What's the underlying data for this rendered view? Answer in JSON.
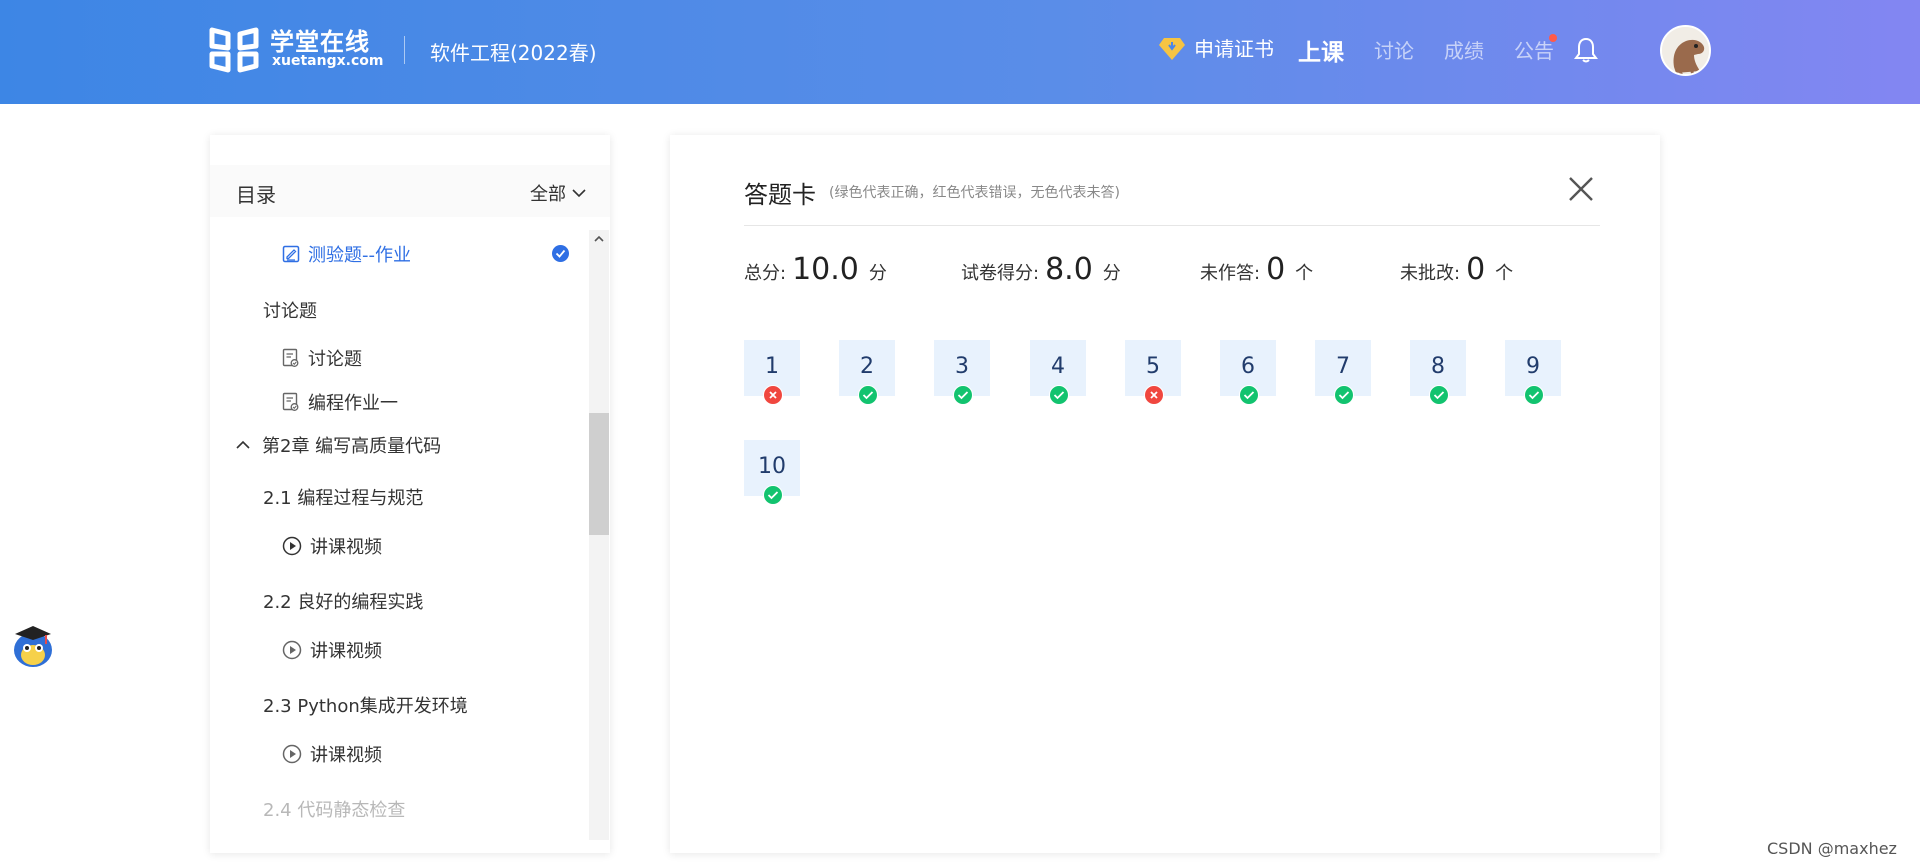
{
  "header": {
    "brand_cn": "学堂在线",
    "brand_en": "xuetangx.com",
    "course_title": "软件工程(2022春)",
    "nav": {
      "certificate": "申请证书",
      "class": "上课",
      "discussion": "讨论",
      "grades": "成绩",
      "announcements": "公告"
    }
  },
  "sidebar": {
    "title": "目录",
    "filter": "全部",
    "items": [
      {
        "label": "测验题--作业",
        "icon": "quiz-icon",
        "state": "active-completed"
      },
      {
        "label": "讨论题",
        "icon": "",
        "state": "section"
      },
      {
        "label": "讨论题",
        "icon": "discussion-doc-icon",
        "state": "normal"
      },
      {
        "label": "编程作业一",
        "icon": "discussion-doc-icon",
        "state": "normal"
      },
      {
        "label": "第2章 编写高质量代码",
        "icon": "chevron-up-icon",
        "state": "chapter-expanded"
      },
      {
        "label": "2.1 编程过程与规范",
        "icon": "",
        "state": "section"
      },
      {
        "label": "讲课视频",
        "icon": "play-icon",
        "state": "normal"
      },
      {
        "label": "2.2 良好的编程实践",
        "icon": "",
        "state": "section"
      },
      {
        "label": "讲课视频",
        "icon": "play-icon",
        "state": "normal"
      },
      {
        "label": "2.3 Python集成开发环境",
        "icon": "",
        "state": "section"
      },
      {
        "label": "讲课视频",
        "icon": "play-icon",
        "state": "normal"
      },
      {
        "label": "2.4 代码静态检查",
        "icon": "",
        "state": "faded"
      }
    ]
  },
  "answer_card": {
    "title": "答题卡",
    "hint": "(绿色代表正确，红色代表错误，无色代表未答)",
    "stats": [
      {
        "label": "总分:",
        "value": "10.0",
        "unit": "分"
      },
      {
        "label": "试卷得分:",
        "value": "8.0",
        "unit": "分"
      },
      {
        "label": "未作答:",
        "value": "0",
        "unit": "个"
      },
      {
        "label": "未批改:",
        "value": "0",
        "unit": "个"
      }
    ],
    "questions": [
      {
        "num": "1",
        "result": "wrong"
      },
      {
        "num": "2",
        "result": "correct"
      },
      {
        "num": "3",
        "result": "correct"
      },
      {
        "num": "4",
        "result": "correct"
      },
      {
        "num": "5",
        "result": "wrong"
      },
      {
        "num": "6",
        "result": "correct"
      },
      {
        "num": "7",
        "result": "correct"
      },
      {
        "num": "8",
        "result": "correct"
      },
      {
        "num": "9",
        "result": "correct"
      },
      {
        "num": "10",
        "result": "correct"
      }
    ],
    "colors": {
      "correct": "#12c36f",
      "wrong": "#f0473f",
      "box": "#e8f2fd"
    }
  },
  "watermark": "CSDN @maxhez"
}
